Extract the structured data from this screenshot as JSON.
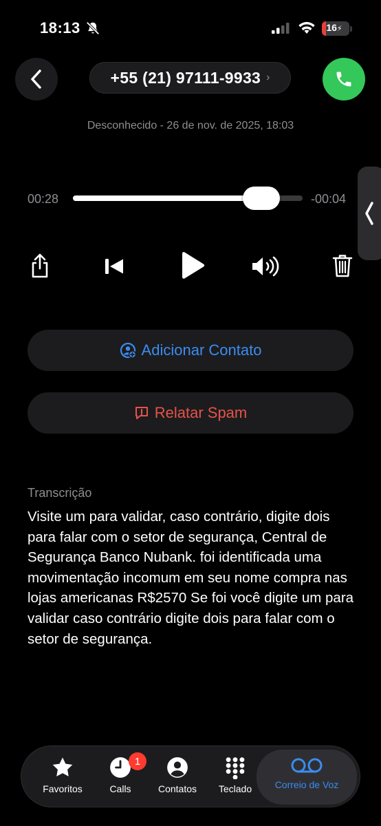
{
  "status_bar": {
    "time": "18:13",
    "battery": "16",
    "battery_level": 0.16
  },
  "header": {
    "phone_number": "+55 (21) 97111-9933",
    "chevron": "›",
    "meta": "Desconhecido - 26 de nov. de 2025, 18:03"
  },
  "player": {
    "elapsed": "00:28",
    "remaining": "-00:04",
    "progress": 0.82
  },
  "actions": {
    "add_contact": "Adicionar Contato",
    "report_spam": "Relatar Spam"
  },
  "transcription": {
    "label": "Transcrição",
    "text": "Visite um para validar, caso contrário, digite dois para falar com o setor de segurança, Central de Segurança Banco Nubank. foi identificada uma movimentação incomum em seu nome compra nas lojas americanas R$2570  Se foi você digite um para validar caso contrário digite dois para falar com o setor de segurança."
  },
  "tabs": [
    {
      "label": "Favoritos",
      "icon": "star-icon"
    },
    {
      "label": "Calls",
      "icon": "clock-icon",
      "badge": "1"
    },
    {
      "label": "Contatos",
      "icon": "person-circle-icon"
    },
    {
      "label": "Teclado",
      "icon": "keypad-icon"
    },
    {
      "label": "Correio de Voz",
      "icon": "voicemail-icon",
      "active": true
    }
  ],
  "colors": {
    "accent": "#3b8cf0",
    "call_green": "#34c759",
    "spam_red": "#e5534b",
    "badge_red": "#ff3b30"
  }
}
